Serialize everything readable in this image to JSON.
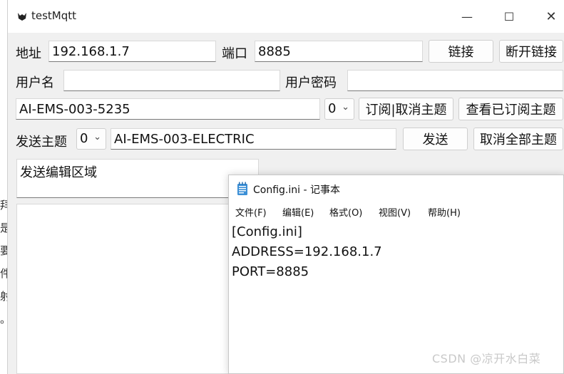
{
  "background": {
    "partial_chars": [
      "拜",
      "是",
      "要",
      "件",
      "射",
      "。"
    ]
  },
  "app": {
    "title": "testMqtt",
    "window_controls": {
      "minimize": "—",
      "maximize": "☐",
      "close": "✕"
    },
    "row1": {
      "address_label": "地址",
      "address_value": "192.168.1.7",
      "port_label": "端口",
      "port_value": "8885",
      "connect_button": "链接",
      "disconnect_button": "断开链接"
    },
    "row2": {
      "username_label": "用户名",
      "username_value": "",
      "password_label": "用户密码",
      "password_value": ""
    },
    "row3": {
      "topic_value": "AI-EMS-003-5235",
      "qos_value": "0",
      "subscribe_button": "订阅|取消主题",
      "view_subscribed_button": "查看已订阅主题"
    },
    "row4": {
      "send_topic_label": "发送主题",
      "qos_value": "0",
      "send_topic_value": "AI-EMS-003-ELECTRIC",
      "send_button": "发送",
      "cancel_all_button": "取消全部主题"
    },
    "edit_area_text": "发送编辑区域"
  },
  "notepad": {
    "title": "Config.ini - 记事本",
    "menu": [
      "文件(F)",
      "编辑(E)",
      "格式(O)",
      "视图(V)",
      "帮助(H)"
    ],
    "content_lines": [
      "[Config.ini]",
      "ADDRESS=192.168.1.7",
      "PORT=8885"
    ]
  },
  "watermark": "CSDN @凉开水白菜",
  "colors": {
    "window_bg": "#f0f0f0",
    "input_bg": "#ffffff",
    "notepad_icon": "#3b8fd6"
  }
}
